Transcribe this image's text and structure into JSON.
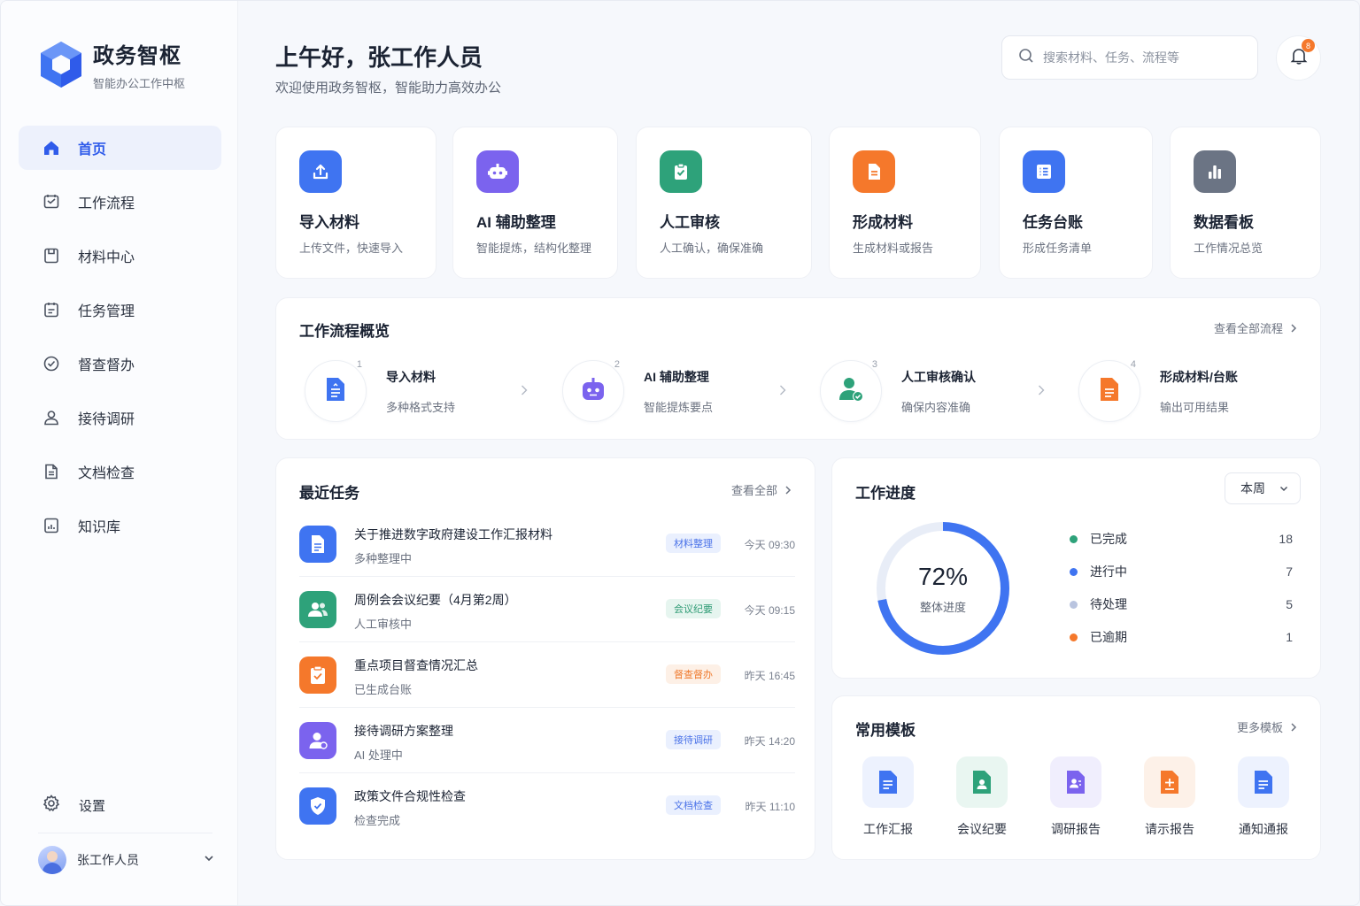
{
  "brand": {
    "name": "政务智枢",
    "subtitle": "智能办公工作中枢"
  },
  "sidebar": {
    "items": [
      {
        "label": "首页",
        "icon": "home-icon",
        "active": true
      },
      {
        "label": "工作流程",
        "icon": "workflow-icon"
      },
      {
        "label": "材料中心",
        "icon": "folder-icon"
      },
      {
        "label": "任务管理",
        "icon": "task-list-icon"
      },
      {
        "label": "督查督办",
        "icon": "check-circle-icon"
      },
      {
        "label": "接待调研",
        "icon": "user-icon"
      },
      {
        "label": "文档检查",
        "icon": "document-icon"
      },
      {
        "label": "知识库",
        "icon": "book-icon"
      }
    ],
    "settings_label": "设置",
    "user_name": "张工作人员"
  },
  "header": {
    "greeting": "上午好，张工作人员",
    "subtitle": "欢迎使用政务智枢，智能助力高效办公",
    "search_placeholder": "搜索材料、任务、流程等",
    "notification_count": "8"
  },
  "quick_actions": [
    {
      "title": "导入材料",
      "desc": "上传文件，快速导入",
      "icon": "upload-icon",
      "color": "#3f74f1"
    },
    {
      "title": "AI 辅助整理",
      "desc": "智能提炼，结构化整理",
      "icon": "robot-icon",
      "color": "#7b63ee"
    },
    {
      "title": "人工审核",
      "desc": "人工确认，确保准确",
      "icon": "clipboard-check-icon",
      "color": "#2ea27a"
    },
    {
      "title": "形成材料",
      "desc": "生成材料或报告",
      "icon": "document-icon",
      "color": "#f5782b"
    },
    {
      "title": "任务台账",
      "desc": "形成任务清单",
      "icon": "list-icon",
      "color": "#3f74f1"
    },
    {
      "title": "数据看板",
      "desc": "工作情况总览",
      "icon": "bar-chart-icon",
      "color": "#6b7484"
    }
  ],
  "workflow": {
    "title": "工作流程概览",
    "link": "查看全部流程",
    "steps": [
      {
        "num": "1",
        "title": "导入材料",
        "desc": "多种格式支持",
        "icon": "document-icon",
        "color": "#3f74f1"
      },
      {
        "num": "2",
        "title": "AI 辅助整理",
        "desc": "智能提炼要点",
        "icon": "robot-icon",
        "color": "#7b63ee"
      },
      {
        "num": "3",
        "title": "人工审核确认",
        "desc": "确保内容准确",
        "icon": "user-check-icon",
        "color": "#2ea27a"
      },
      {
        "num": "4",
        "title": "形成材料/台账",
        "desc": "输出可用结果",
        "icon": "document-icon",
        "color": "#f5782b"
      }
    ]
  },
  "recent_tasks": {
    "title": "最近任务",
    "link": "查看全部",
    "items": [
      {
        "title": "关于推进数字政府建设工作汇报材料",
        "status": "多种整理中",
        "tag": "材料整理",
        "time": "今天 09:30",
        "icon": "document-icon",
        "color": "#3f74f1",
        "tag_color": "#4a72e8",
        "tag_bg": "#eaf0fe"
      },
      {
        "title": "周例会会议纪要（4月第2周）",
        "status": "人工审核中",
        "tag": "会议纪要",
        "time": "今天 09:15",
        "icon": "users-icon",
        "color": "#2ea27a",
        "tag_color": "#2e9b74",
        "tag_bg": "#e6f5ef"
      },
      {
        "title": "重点项目督查情况汇总",
        "status": "已生成台账",
        "tag": "督查督办",
        "time": "昨天 16:45",
        "icon": "clipboard-check-icon",
        "color": "#f5782b",
        "tag_color": "#ef7a2e",
        "tag_bg": "#fdf0e6"
      },
      {
        "title": "接待调研方案整理",
        "status": "AI 处理中",
        "tag": "接待调研",
        "time": "昨天 14:20",
        "icon": "user-icon",
        "color": "#7b63ee",
        "tag_color": "#4a72e8",
        "tag_bg": "#eaf0fe"
      },
      {
        "title": "政策文件合规性检查",
        "status": "检查完成",
        "tag": "文档检查",
        "time": "昨天 11:10",
        "icon": "shield-icon",
        "color": "#3f74f1",
        "tag_color": "#4a72e8",
        "tag_bg": "#eaf0fe"
      }
    ]
  },
  "progress": {
    "title": "工作进度",
    "period": "本周",
    "percent": 72,
    "percent_label": "72%",
    "center_label": "整体进度",
    "legend": [
      {
        "label": "已完成",
        "value": "18",
        "color": "#2ea27a"
      },
      {
        "label": "进行中",
        "value": "7",
        "color": "#3f74f1"
      },
      {
        "label": "待处理",
        "value": "5",
        "color": "#b9c4df"
      },
      {
        "label": "已逾期",
        "value": "1",
        "color": "#f5782b"
      }
    ],
    "ring_color": "#3f74f1",
    "track_color": "#e8edf7"
  },
  "templates": {
    "title": "常用模板",
    "link": "更多模板",
    "items": [
      {
        "label": "工作汇报",
        "icon": "document-icon",
        "color": "#3f74f1",
        "bg": "#edf2fe"
      },
      {
        "label": "会议纪要",
        "icon": "document-user-icon",
        "color": "#2ea27a",
        "bg": "#e9f6f1"
      },
      {
        "label": "调研报告",
        "icon": "document-user-icon",
        "color": "#7b63ee",
        "bg": "#f0eefd"
      },
      {
        "label": "请示报告",
        "icon": "document-plus-icon",
        "color": "#f5782b",
        "bg": "#fdf1e8"
      },
      {
        "label": "通知通报",
        "icon": "document-icon",
        "color": "#3f74f1",
        "bg": "#edf2fe"
      }
    ]
  }
}
